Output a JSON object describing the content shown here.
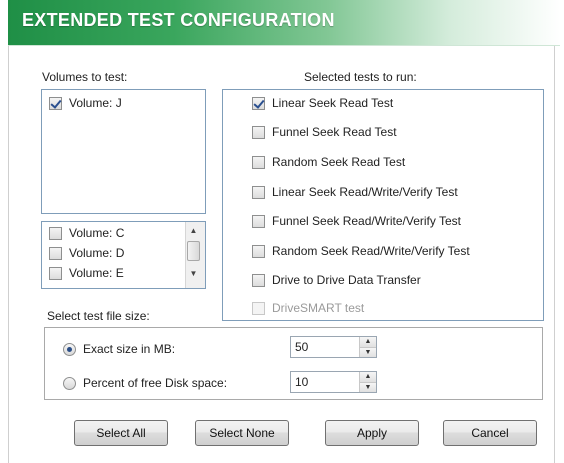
{
  "header": {
    "title": "EXTENDED TEST CONFIGURATION"
  },
  "volumes": {
    "label": "Volumes to test:",
    "selected_list": [
      {
        "label": "Volume: J",
        "checked": true
      }
    ],
    "available_list": [
      {
        "label": "Volume: C",
        "checked": false
      },
      {
        "label": "Volume: D",
        "checked": false
      },
      {
        "label": "Volume: E",
        "checked": false
      }
    ]
  },
  "tests": {
    "label": "Selected tests to run:",
    "items": [
      {
        "label": "Linear Seek Read Test",
        "checked": true,
        "enabled": true
      },
      {
        "label": "Funnel Seek Read Test",
        "checked": false,
        "enabled": true
      },
      {
        "label": "Random Seek Read Test",
        "checked": false,
        "enabled": true
      },
      {
        "label": "Linear Seek Read/Write/Verify Test",
        "checked": false,
        "enabled": true
      },
      {
        "label": "Funnel Seek Read/Write/Verify Test",
        "checked": false,
        "enabled": true
      },
      {
        "label": "Random Seek Read/Write/Verify Test",
        "checked": false,
        "enabled": true
      },
      {
        "label": "Drive to Drive Data Transfer",
        "checked": false,
        "enabled": true
      },
      {
        "label": "DriveSMART test",
        "checked": false,
        "enabled": false
      }
    ]
  },
  "file_size": {
    "label": "Select test file size:",
    "options": [
      {
        "label": "Exact size in MB:",
        "selected": true,
        "value": "50"
      },
      {
        "label": "Percent of free Disk space:",
        "selected": false,
        "value": "10"
      }
    ]
  },
  "buttons": {
    "select_all": "Select All",
    "select_none": "Select None",
    "apply": "Apply",
    "cancel": "Cancel"
  },
  "colors": {
    "header_green": "#1f8f46",
    "checkmark": "#2a4f8f"
  }
}
